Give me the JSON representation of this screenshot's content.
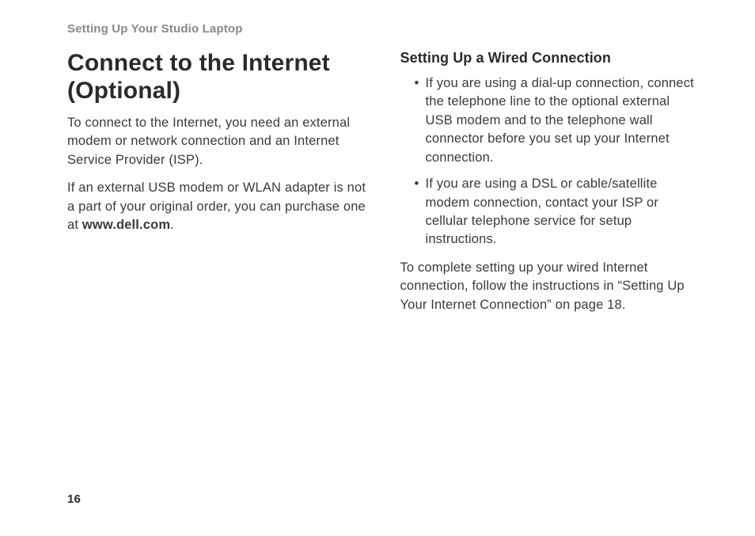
{
  "header": "Setting Up Your Studio Laptop",
  "left": {
    "heading": "Connect to the Internet (Optional)",
    "para1": "To connect to the Internet, you need an external modem or network connection and an Internet Service Provider (ISP).",
    "para2_pre": "If an external USB modem or WLAN adapter is not a part of your original order, you can purchase one at ",
    "para2_bold": "www.dell.com",
    "para2_post": "."
  },
  "right": {
    "subheading": "Setting Up a Wired Connection",
    "bullets": [
      "If you are using a dial-up connection, connect the telephone line to the optional external USB modem and to the telephone wall connector before you set up your Internet connection.",
      "If you are using a DSL or cable/satellite modem connection, contact your ISP or cellular telephone service for setup instructions."
    ],
    "para_after": "To complete setting up your wired Internet connection, follow the instructions in “Setting Up Your Internet Connection” on page 18."
  },
  "page_number": "16"
}
